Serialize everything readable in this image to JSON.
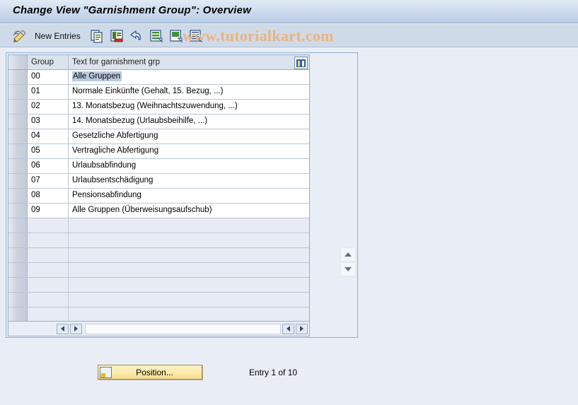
{
  "window": {
    "title": "Change View \"Garnishment Group\": Overview"
  },
  "toolbar": {
    "edit_icon": "pencil-edit-icon",
    "new_entries_label": "New Entries",
    "icons": [
      {
        "name": "copy-icon"
      },
      {
        "name": "delete-row-icon"
      },
      {
        "name": "undo-arrow-icon"
      },
      {
        "name": "select-all-icon"
      },
      {
        "name": "deselect-all-icon"
      },
      {
        "name": "details-icon"
      }
    ]
  },
  "watermark": {
    "text": "www.tutorialkart.com",
    "mark": "©",
    "color": "#e8b483"
  },
  "table": {
    "config_icon": "column-config-icon",
    "columns": [
      "Group",
      "Text for garnishment grp"
    ],
    "rows": [
      {
        "group": "00",
        "text": "Alle Gruppen",
        "selected": true
      },
      {
        "group": "01",
        "text": "Normale Einkünfte (Gehalt, 15. Bezug, ...)",
        "selected": false
      },
      {
        "group": "02",
        "text": "13. Monatsbezug (Weihnachtszuwendung, ...)",
        "selected": false
      },
      {
        "group": "03",
        "text": "14. Monatsbezug (Urlaubsbeihilfe, ...)",
        "selected": false
      },
      {
        "group": "04",
        "text": "Gesetzliche Abfertigung",
        "selected": false
      },
      {
        "group": "05",
        "text": "Vertragliche Abfertigung",
        "selected": false
      },
      {
        "group": "06",
        "text": "Urlaubsabfindung",
        "selected": false
      },
      {
        "group": "07",
        "text": "Urlaubsentschädigung",
        "selected": false
      },
      {
        "group": "08",
        "text": "Pensionsabfindung",
        "selected": false
      },
      {
        "group": "09",
        "text": "Alle Gruppen (Überweisungsaufschub)",
        "selected": false
      }
    ],
    "empty_row_count": 7
  },
  "footer": {
    "position_button_label": "Position...",
    "position_button_icon": "position-icon",
    "entry_status": "Entry 1 of 10"
  },
  "colors": {
    "titlebar_top": "#e2eaf5",
    "titlebar_bottom": "#b9cde5",
    "toolbar_bg": "#cfdae8",
    "page_bg": "#e9eef6",
    "selection": "#b9cade",
    "button_yellow": "#fbe9a8"
  }
}
